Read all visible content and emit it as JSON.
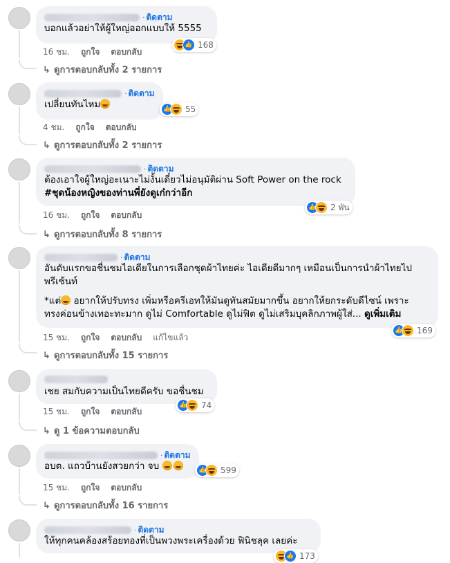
{
  "labels": {
    "follow": "ติดตาม",
    "like": "ถูกใจ",
    "reply": "ตอบกลับ",
    "edited": "แก้ไขแล้ว",
    "see_more": "ดูเพิ่มเติม",
    "reply_arrow": "↳"
  },
  "colors": {
    "accent": "#1b74e4",
    "bubble": "#f0f2f5",
    "muted": "#65676b",
    "like": "#1877f2",
    "haha": "#f7b928"
  },
  "comments": [
    {
      "text": "บอกแล้วอย่าให้ผู้ใหญ่ออกแบบให้ 5555",
      "time": "16 ชม.",
      "reaction_count": "168",
      "reaction_icons": [
        "haha-icon",
        "like-icon"
      ],
      "replies": "ดูการตอบกลับทั้ง 2 รายการ"
    },
    {
      "text": "เปลี่ยนทันไหม",
      "time": "4 ชม.",
      "reaction_count": "55",
      "reaction_icons": [
        "like-icon",
        "haha-icon"
      ],
      "replies": "ดูการตอบกลับทั้ง 2 รายการ"
    },
    {
      "text": "ต้องเอาใจผู้ใหญ่อะเนาะไม่งั้นเดี๋ยวไม่อนุมัติผ่าน Soft Power on the rock",
      "hashtag": "#ชุดน้องหญิงของท่านพี่ยังดูเก๋กว่าอีก",
      "time": "16 ชม.",
      "reaction_count": "2 พัน",
      "reaction_icons": [
        "like-icon",
        "haha-icon"
      ],
      "replies": "ดูการตอบกลับทั้ง 8 รายการ"
    },
    {
      "text_line1": "อันดับแรกขอชื่นชมไอเดียในการเลือกชุดผ้าไทยค่ะ ไอเดียดีมากๆ เหมือนเป็นการนำผ้าไทยไป",
      "text_line2": "พรีเซ้นท์",
      "text_p2_a": "*แต่",
      "text_p2_b": " อยากให้ปรับทรง เพิ่มหรือครีเอทให้มันดูทันสมัยมากขึ้น อยากให้ยกระดับดีไซน์ เพราะ",
      "text_p2_c": "ทรงค่อนข้างเทอะทะมาก ดูไม่ Comfortable ดูไม่ฟิต ดูไม่เสริมบุคลิกภาพผู้ใส่... ",
      "time": "15 ชม.",
      "reaction_count": "169",
      "reaction_icons": [
        "like-icon",
        "haha-icon"
      ],
      "replies": "ดูการตอบกลับทั้ง 15 รายการ"
    },
    {
      "text": "เชย สมกับความเป็นไทยดีครับ ขอชื่นชม",
      "time": "15 ชม.",
      "reaction_count": "74",
      "reaction_icons": [
        "like-icon",
        "haha-icon"
      ],
      "replies": "ดู 1 ข้อความตอบกลับ"
    },
    {
      "text": "อบต. แถวบ้านยังสวยกว่า จบ",
      "time": "15 ชม.",
      "reaction_count": "599",
      "reaction_icons": [
        "like-icon",
        "haha-icon"
      ],
      "replies": "ดูการตอบกลับทั้ง 16 รายการ"
    },
    {
      "text": "ให้ทุกคนคล้องสร้อยทองที่เป็นพวงพระเครื่องด้วย ฟินิชลุค เลยค่ะ",
      "reaction_count": "173",
      "reaction_icons": [
        "haha-icon",
        "like-icon"
      ]
    }
  ]
}
